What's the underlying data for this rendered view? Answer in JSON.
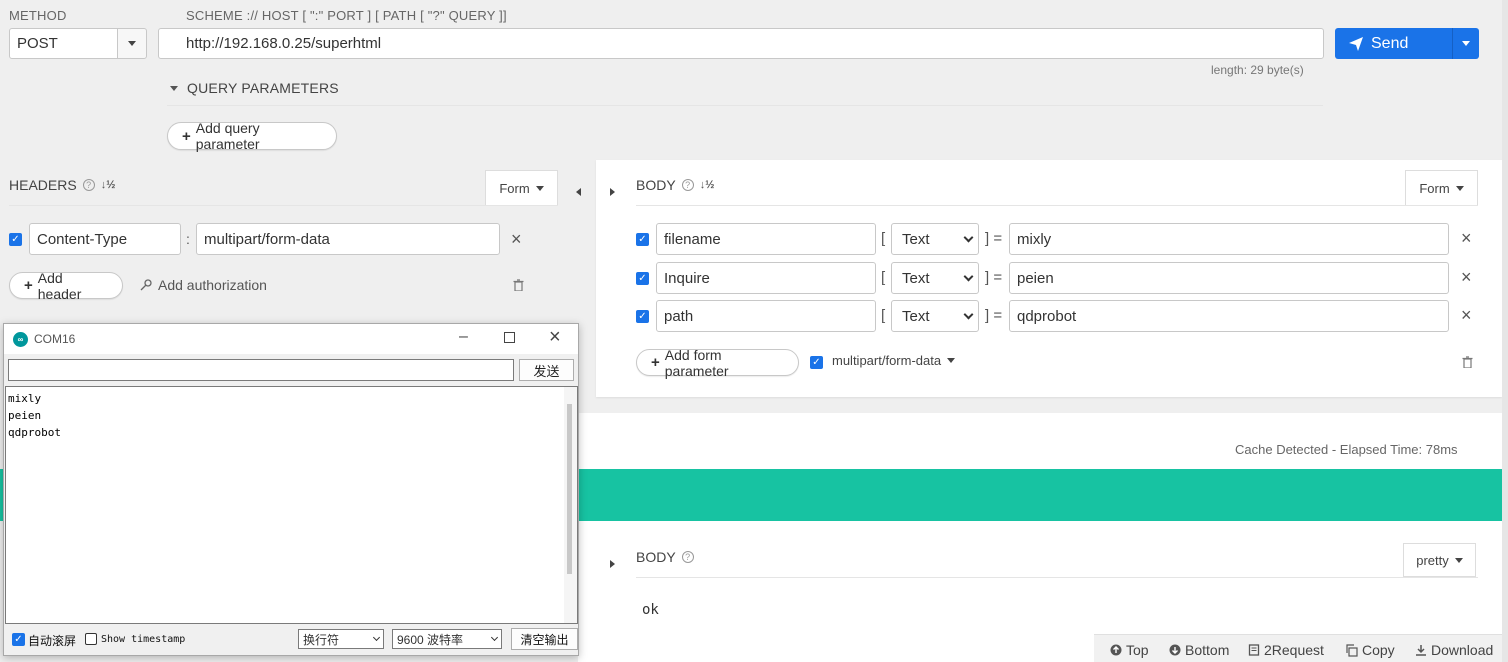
{
  "request": {
    "method_label": "METHOD",
    "method_value": "POST",
    "url_label": "SCHEME :// HOST [ \":\" PORT ] [ PATH [ \"?\" QUERY ]]",
    "url_value": "http://192.168.0.25/superhtml",
    "length_text": "length: 29 byte(s)",
    "send_label": "Send",
    "query_params_label": "QUERY PARAMETERS",
    "add_query_label": "Add query parameter"
  },
  "headers": {
    "title": "HEADERS",
    "mode": "Form",
    "items": [
      {
        "key": "Content-Type",
        "value": "multipart/form-data",
        "checked": true
      }
    ],
    "add_header_label": "Add header",
    "add_auth_label": "Add authorization"
  },
  "body": {
    "title": "BODY",
    "mode": "Form",
    "items": [
      {
        "key": "filename",
        "type": "Text",
        "value": "mixly",
        "checked": true
      },
      {
        "key": "Inquire",
        "type": "Text",
        "value": "peien",
        "checked": true
      },
      {
        "key": "path",
        "type": "Text",
        "value": "qdprobot",
        "checked": true
      }
    ],
    "add_form_label": "Add form parameter",
    "content_type": "multipart/form-data"
  },
  "response": {
    "cache_text": "Cache Detected - Elapsed Time: 78ms",
    "body_title": "BODY",
    "body_mode": "pretty",
    "body_content": "ok",
    "status_color": "#17c3a2"
  },
  "footer": {
    "top": "Top",
    "bottom": "Bottom",
    "request": "2Request",
    "copy": "Copy",
    "download": "Download"
  },
  "serial": {
    "title": "COM16",
    "send_label": "发送",
    "input_value": "",
    "output_lines": [
      "mixly",
      "peien",
      "qdprobot"
    ],
    "autoscroll_label": "自动滚屏",
    "autoscroll_checked": true,
    "timestamp_label": "Show timestamp",
    "timestamp_checked": false,
    "line_ending": "换行符",
    "baud": "9600 波特率",
    "clear_label": "清空输出"
  },
  "colors": {
    "accent": "#1a73e8",
    "teal": "#17c3a2"
  }
}
